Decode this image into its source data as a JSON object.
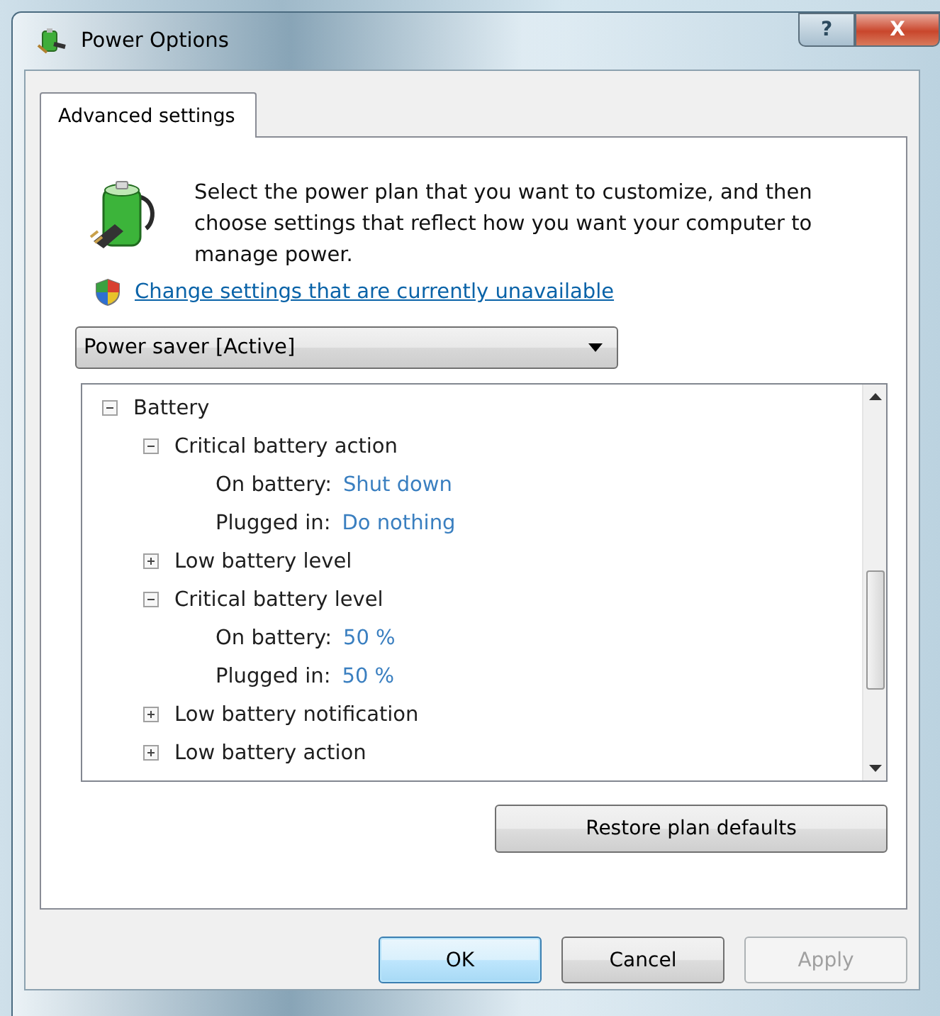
{
  "window": {
    "title": "Power Options",
    "title_buttons": [
      {
        "kind": "help",
        "label": "?"
      },
      {
        "kind": "close",
        "label": "X"
      }
    ]
  },
  "tabs": [
    {
      "label": "Advanced settings",
      "selected": true
    }
  ],
  "description": "Select the power plan that you want to customize, and then choose settings that reflect how you want your computer to manage power.",
  "link": "Change settings that are currently unavailable",
  "plan_dropdown": {
    "value": "Power saver [Active]"
  },
  "tree": [
    {
      "label": "Battery",
      "expanded": true,
      "children": [
        {
          "label": "Critical battery action",
          "expanded": true,
          "children": [
            {
              "kind": "setting",
              "label": "On battery:",
              "value": "Shut down"
            },
            {
              "kind": "setting",
              "label": "Plugged in:",
              "value": "Do nothing"
            }
          ]
        },
        {
          "label": "Low battery level",
          "expanded": false
        },
        {
          "label": "Critical battery level",
          "expanded": true,
          "children": [
            {
              "kind": "setting",
              "label": "On battery:",
              "value": "50 %"
            },
            {
              "kind": "setting",
              "label": "Plugged in:",
              "value": "50 %"
            }
          ]
        },
        {
          "label": "Low battery notification",
          "expanded": false
        },
        {
          "label": "Low battery action",
          "expanded": false
        }
      ]
    }
  ],
  "restore_button": {
    "label": "Restore plan defaults"
  },
  "buttons": [
    {
      "label": "OK",
      "default": true,
      "disabled": false
    },
    {
      "label": "Cancel",
      "default": false,
      "disabled": false
    },
    {
      "label": "Apply",
      "default": false,
      "disabled": true
    }
  ]
}
